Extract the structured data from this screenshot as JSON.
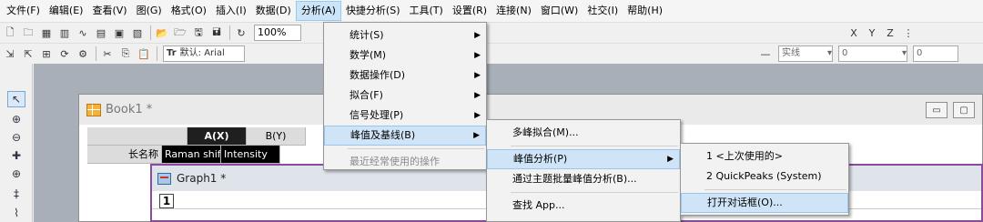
{
  "menubar": {
    "items": [
      {
        "label": "文件(F)"
      },
      {
        "label": "编辑(E)"
      },
      {
        "label": "查看(V)"
      },
      {
        "label": "图(G)"
      },
      {
        "label": "格式(O)"
      },
      {
        "label": "插入(I)"
      },
      {
        "label": "数据(D)"
      },
      {
        "label": "分析(A)",
        "active": true
      },
      {
        "label": "快捷分析(S)"
      },
      {
        "label": "工具(T)"
      },
      {
        "label": "设置(R)"
      },
      {
        "label": "连接(N)"
      },
      {
        "label": "窗口(W)"
      },
      {
        "label": "社交(I)"
      },
      {
        "label": "帮助(H)"
      }
    ]
  },
  "toolbar1": {
    "zoom_value": "100%",
    "right_labels": [
      "X",
      "Y",
      "Z"
    ]
  },
  "toolbar2": {
    "font_prefix": "Tr",
    "font_value": "默认: Arial",
    "style_label": "实线",
    "width_value": "0",
    "box_value": "0"
  },
  "analysis_menu": {
    "items": [
      {
        "label": "统计(S)",
        "submenu": true
      },
      {
        "label": "数学(M)",
        "submenu": true
      },
      {
        "label": "数据操作(D)",
        "submenu": true
      },
      {
        "label": "拟合(F)",
        "submenu": true
      },
      {
        "label": "信号处理(P)",
        "submenu": true
      },
      {
        "label": "峰值及基线(B)",
        "submenu": true,
        "highlighted": true
      }
    ],
    "recent_label": "最近经常使用的操作"
  },
  "peaks_menu": {
    "items": [
      {
        "label": "多峰拟合(M)..."
      },
      {
        "label": "峰值分析(P)",
        "submenu": true,
        "highlighted": true
      },
      {
        "label": "通过主题批量峰值分析(B)..."
      },
      {
        "label": "查找 App..."
      }
    ]
  },
  "peak_analysis_menu": {
    "items": [
      {
        "label": "1 <上次使用的>"
      },
      {
        "label": "2 QuickPeaks (System)"
      },
      {
        "label": "打开对话框(O)...",
        "highlighted": true
      }
    ]
  },
  "book_window": {
    "title": "Book1 *",
    "col_a": "A(X)",
    "col_b": "B(Y)",
    "row_label": "长名称",
    "cell_a": "Raman shift",
    "cell_b": "Intensity"
  },
  "graph_window": {
    "title": "Graph1 *",
    "layer": "1"
  },
  "colors": {
    "menu_highlight": "#cfe4f6",
    "workspace": "#a9afb8",
    "graph_border": "#8a4b9c"
  }
}
